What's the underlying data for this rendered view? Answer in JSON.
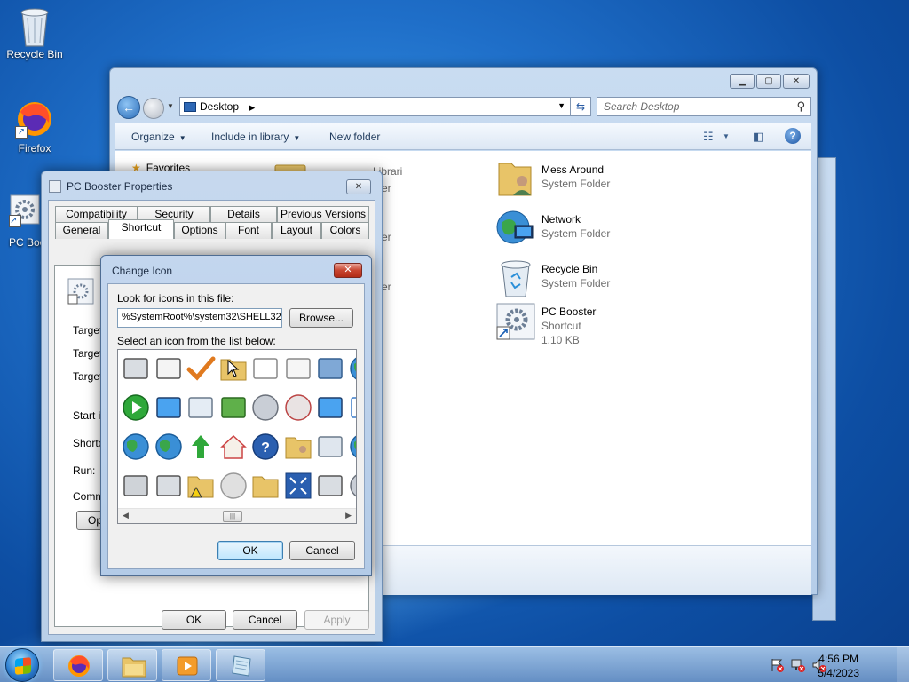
{
  "desktop": {
    "icons": [
      {
        "label": "Recycle Bin"
      },
      {
        "label": "Firefox"
      },
      {
        "label": "PC Boo"
      }
    ]
  },
  "explorer": {
    "address": "Desktop",
    "search_placeholder": "Search Desktop",
    "toolbar": {
      "organize": "Organize",
      "include_in_library": "Include in library",
      "new_folder": "New folder"
    },
    "nav_pane": {
      "favorites": "Favorites"
    },
    "ghost_items": [
      "Librari",
      "er",
      "er",
      "er",
      "er"
    ],
    "items": [
      {
        "name": "Mess Around",
        "type": "System Folder",
        "icon": "user-folder-icon"
      },
      {
        "name": "Network",
        "type": "System Folder",
        "icon": "network-globe-icon"
      },
      {
        "name": "Recycle Bin",
        "type": "System Folder",
        "icon": "recycle-bin-icon"
      },
      {
        "name": "PC Booster",
        "type": "Shortcut",
        "size": "1.10 KB",
        "icon": "shortcut-gear-icon"
      }
    ]
  },
  "properties": {
    "title": "PC Booster Properties",
    "tabs_row1": [
      "Compatibility",
      "Security",
      "Details",
      "Previous Versions"
    ],
    "tabs_row2": [
      "General",
      "Shortcut",
      "Options",
      "Font",
      "Layout",
      "Colors"
    ],
    "active_tab": "Shortcut",
    "labels": {
      "target_type": "Target ty",
      "target_location": "Target lo",
      "target": "Target:",
      "start_in": "Start in:",
      "shortcut_key": "Shortcut",
      "run": "Run:",
      "comment": "Commer"
    },
    "open_button": "Ope",
    "buttons": {
      "ok": "OK",
      "cancel": "Cancel",
      "apply": "Apply"
    }
  },
  "change_icon": {
    "title": "Change Icon",
    "look_label": "Look for icons in this file:",
    "path_value": "%SystemRoot%\\system32\\SHELL32.dll",
    "browse_button": "Browse...",
    "select_label": "Select an icon from the list below:",
    "icons": [
      "printer-icon",
      "projector-icon",
      "checkmark-icon",
      "folder-share-icon",
      "document-delete-icon",
      "mail-icon",
      "users-icon",
      "globe-icon",
      "play-icon",
      "monitor-brush-icon",
      "recycle-bin-full-icon",
      "network-tree-icon",
      "disc-search-icon",
      "cd-icon",
      "computer-network-icon",
      "checklist-icon",
      "globe-network-icon",
      "globe-image-icon",
      "up-arrow-icon",
      "home-network-icon",
      "help-icon",
      "users-folder-icon",
      "window-icon",
      "globe2-icon",
      "camera-icon",
      "scanner-icon",
      "folders-warning-icon",
      "dvd-icon",
      "folder-icon",
      "fullscreen-icon",
      "printer-fax-icon",
      "disc2-icon"
    ],
    "buttons": {
      "ok": "OK",
      "cancel": "Cancel"
    }
  },
  "taskbar": {
    "clock_time": "4:56 PM",
    "clock_date": "5/4/2023",
    "pinned": [
      "firefox-icon",
      "explorer-folder-icon",
      "media-player-icon",
      "notepad-icon"
    ]
  },
  "colors": {
    "accent": "#2a6cb8",
    "close_red": "#c8442f"
  }
}
